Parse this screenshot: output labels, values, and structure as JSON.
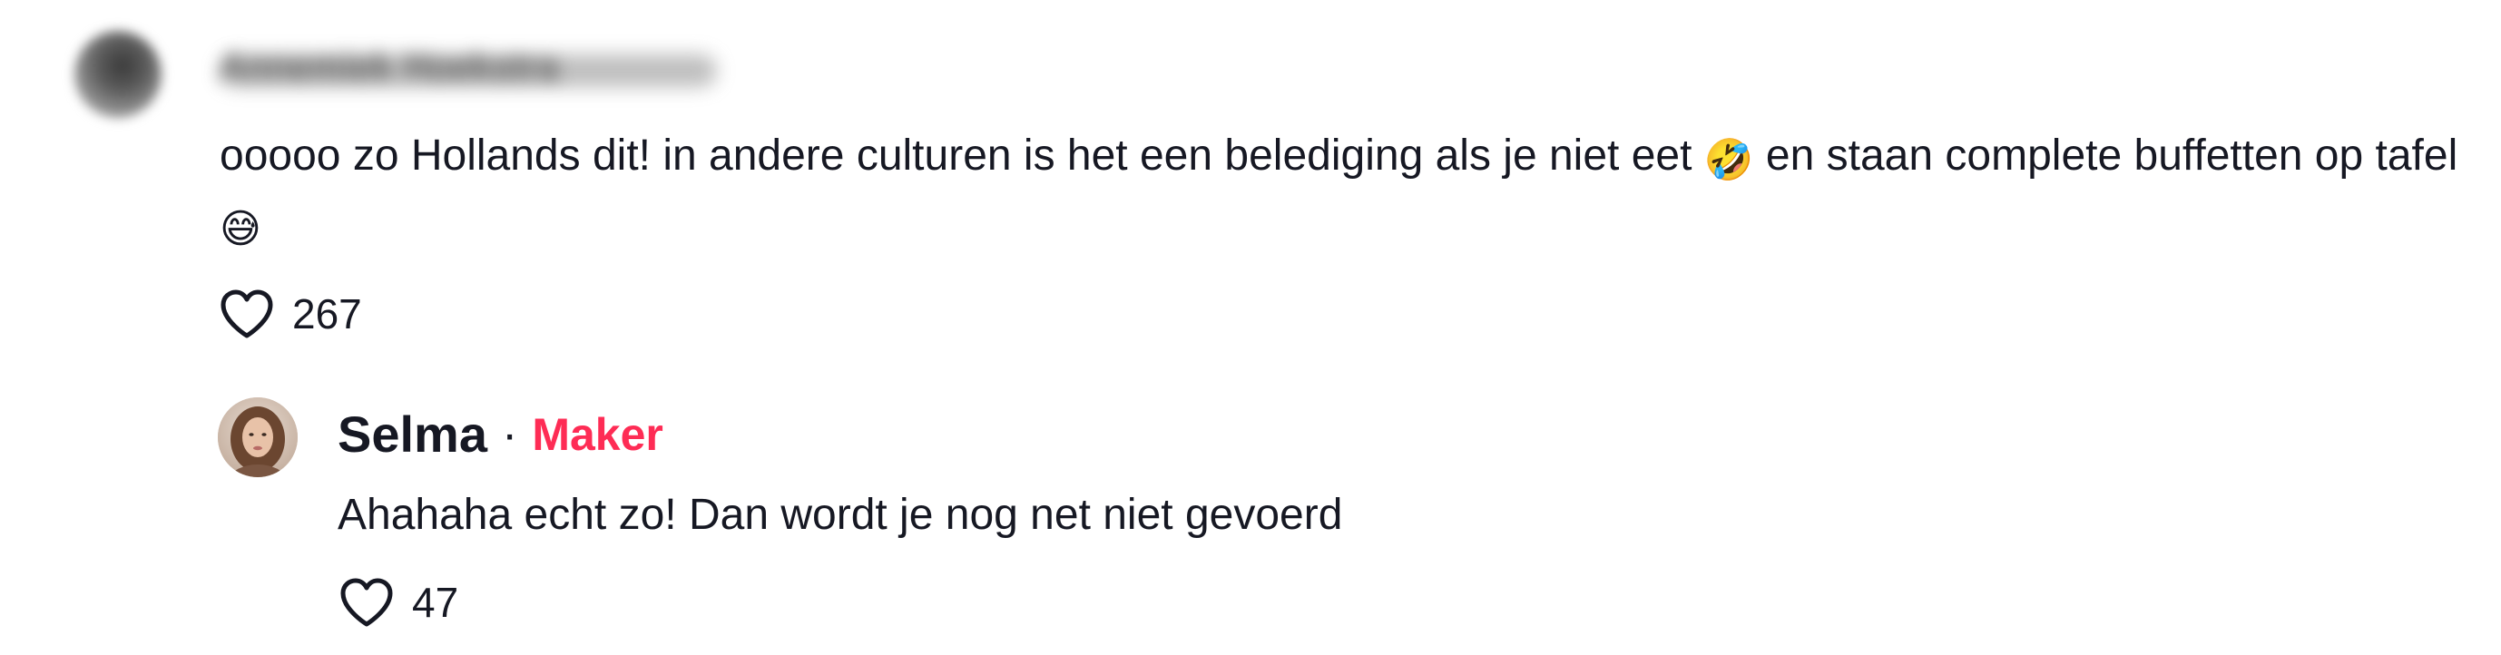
{
  "comments": [
    {
      "username": "Annemiek Hoekstra",
      "text_before_emoji": "ooooo zo Hollands dit! in andere culturen is het een belediging als je niet eet ",
      "emoji_1": "🤣",
      "text_middle": " en staan complete buffetten op tafel",
      "emoji_2": "😅",
      "likes": "267"
    }
  ],
  "reply": {
    "username": "Selma",
    "separator": "·",
    "badge": "Maker",
    "text": "Ahahaha echt zo! Dan wordt je nog net niet gevoerd",
    "likes": "47"
  },
  "colors": {
    "text": "#161823",
    "badge": "#fe2c55",
    "background": "#ffffff"
  },
  "icons": {
    "like": "heart-outline-icon"
  }
}
